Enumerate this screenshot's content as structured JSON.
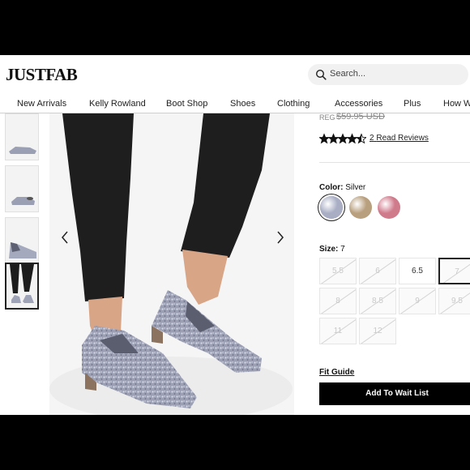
{
  "brand": {
    "logo": "JUSTFAB"
  },
  "search": {
    "placeholder": "Search..."
  },
  "nav": {
    "items": [
      "New Arrivals",
      "Kelly Rowland",
      "Boot Shop",
      "Shoes",
      "Clothing",
      "Accessories",
      "Plus",
      "How W"
    ]
  },
  "product": {
    "reg_label": "REG",
    "reg_price": "$59.95 USD",
    "rating": 4.5,
    "reviews_count": "2",
    "reviews_label": "Read Reviews",
    "color_label": "Color:",
    "color_value": "Silver",
    "swatches": [
      {
        "name": "Silver",
        "color": "#a9aec4"
      },
      {
        "name": "Gold",
        "color": "#b89f7d"
      },
      {
        "name": "Pink",
        "color": "#d07b8c"
      }
    ],
    "size_label": "Size:",
    "size_value": "7",
    "sizes": [
      {
        "label": "5.5",
        "available": false
      },
      {
        "label": "6",
        "available": false
      },
      {
        "label": "6.5",
        "available": true
      },
      {
        "label": "7",
        "available": false,
        "selected": true
      },
      {
        "label": "8",
        "available": false
      },
      {
        "label": "8.5",
        "available": false
      },
      {
        "label": "9",
        "available": false
      },
      {
        "label": "9.5",
        "available": false
      },
      {
        "label": "11",
        "available": false
      },
      {
        "label": "12",
        "available": false
      }
    ],
    "fit_guide": "Fit Guide",
    "cta": "Add To Wait List"
  },
  "colors": {
    "accent": "#000000",
    "muted": "#888888"
  }
}
